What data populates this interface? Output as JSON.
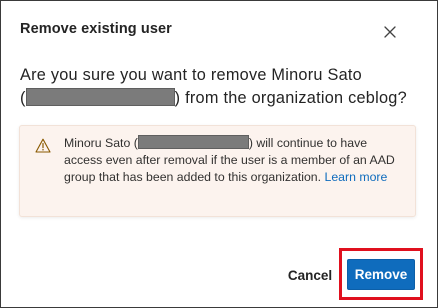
{
  "dialog": {
    "title": "Remove existing user",
    "close_icon": "close-icon",
    "question": {
      "before": "Are you sure you want to remove Minoru Sato",
      "open_paren": "(",
      "after": ") from the organization ceblog?"
    },
    "warning": {
      "icon": "warning-triangle-icon",
      "before": "Minoru Sato (",
      "after": ") will continue to have access even after removal if the user is a member of an AAD group that has been added to this organization.",
      "link": "Learn more"
    },
    "buttons": {
      "cancel": "Cancel",
      "remove": "Remove"
    }
  },
  "colors": {
    "primary": "#0f6cbd",
    "warning_bg": "#fcf3ee",
    "highlight": "#e0101e",
    "redaction": "#7b7b7b"
  }
}
